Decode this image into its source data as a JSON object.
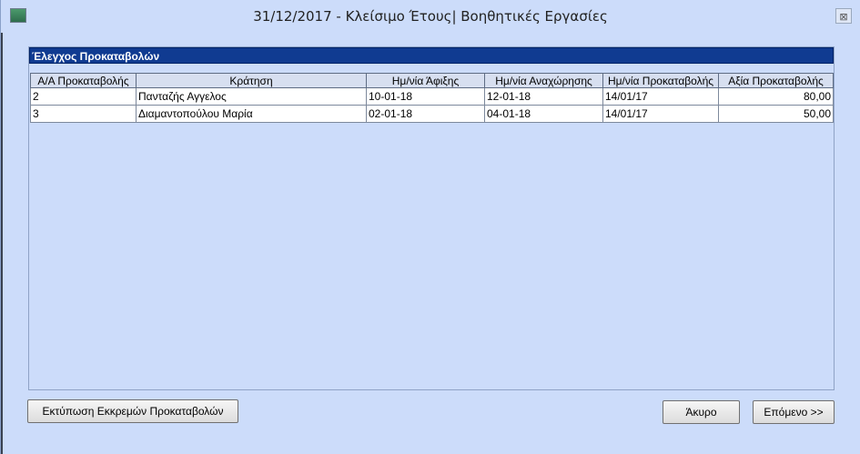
{
  "window": {
    "title": "31/12/2017 - Κλείσιμο Έτους| Βοηθητικές Εργασίες",
    "close_glyph": "⊠"
  },
  "panel": {
    "header": "Έλεγχος Προκαταβολών"
  },
  "table": {
    "columns": [
      "Α/Α Προκαταβολής",
      "Κράτηση",
      "Ημ/νία Άφιξης",
      "Ημ/νία Αναχώρησης",
      "Ημ/νία Προκαταβολής",
      "Αξία Προκαταβολής"
    ],
    "rows": [
      [
        "2",
        "Πανταζής Αγγελος",
        "10-01-18",
        "12-01-18",
        "14/01/17",
        "80,00"
      ],
      [
        "3",
        "Διαμαντοπούλου  Μαρία",
        "02-01-18",
        "04-01-18",
        "14/01/17",
        "50,00"
      ]
    ]
  },
  "buttons": {
    "print": "Εκτύπωση Εκκρεμών Προκαταβολών",
    "cancel": "Άκυρο",
    "next": "Επόμενο >>"
  }
}
